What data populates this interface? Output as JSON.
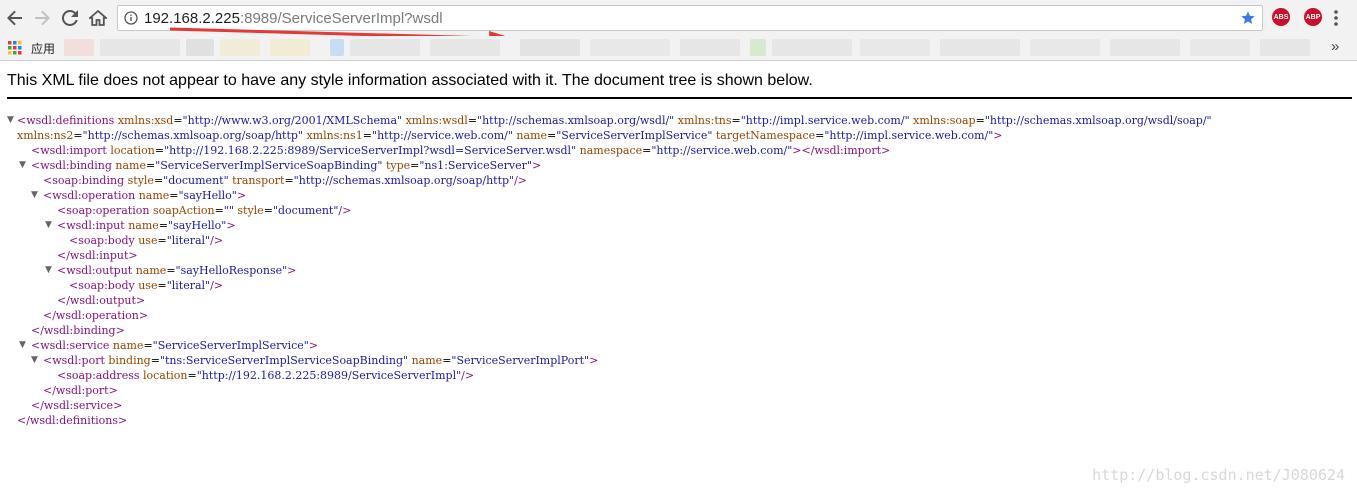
{
  "browser": {
    "url_host": "192.168.2.225",
    "url_rest": ":8989/ServiceServerImpl?wsdl",
    "apps_label": "应用",
    "ext_abs": "ABS",
    "ext_abp": "ABP",
    "more_glyph": "»"
  },
  "page": {
    "notice": "This XML file does not appear to have any style information associated with it. The document tree is shown below.",
    "watermark": "http://blog.csdn.net/J080624"
  },
  "colors": {
    "tag": "#881280",
    "attr": "#994500",
    "value": "#1a1aa6",
    "annotation_arrow": "#e53935"
  },
  "xml": {
    "l1": {
      "open": "<wsdl:definitions",
      "a1": "xmlns:xsd",
      "v1": "\"http://www.w3.org/2001/XMLSchema\"",
      "a2": "xmlns:wsdl",
      "v2": "\"http://schemas.xmlsoap.org/wsdl/\"",
      "a3": "xmlns:tns",
      "v3": "\"http://impl.service.web.com/\"",
      "a4": "xmlns:soap",
      "v4": "\"http://schemas.xmlsoap.org/wsdl/soap/\""
    },
    "l2": {
      "a1": "xmlns:ns2",
      "v1": "\"http://schemas.xmlsoap.org/soap/http\"",
      "a2": "xmlns:ns1",
      "v2": "\"http://service.web.com/\"",
      "a3": "name",
      "v3": "\"ServiceServerImplService\"",
      "a4": "targetNamespace",
      "v4": "\"http://impl.service.web.com/\"",
      "close": ">"
    },
    "l3": {
      "open": "<wsdl:import",
      "a1": "location",
      "v1": "\"http://192.168.2.225:8989/ServiceServerImpl?wsdl=ServiceServer.wsdl\"",
      "a2": "namespace",
      "v2": "\"http://service.web.com/\"",
      "close": "></wsdl:import>"
    },
    "l4": {
      "open": "<wsdl:binding",
      "a1": "name",
      "v1": "\"ServiceServerImplServiceSoapBinding\"",
      "a2": "type",
      "v2": "\"ns1:ServiceServer\"",
      "close": ">"
    },
    "l5": {
      "open": "<soap:binding",
      "a1": "style",
      "v1": "\"document\"",
      "a2": "transport",
      "v2": "\"http://schemas.xmlsoap.org/soap/http\"",
      "close": "/>"
    },
    "l6": {
      "open": "<wsdl:operation",
      "a1": "name",
      "v1": "\"sayHello\"",
      "close": ">"
    },
    "l7": {
      "open": "<soap:operation",
      "a1": "soapAction",
      "v1": "\"\"",
      "a2": "style",
      "v2": "\"document\"",
      "close": "/>"
    },
    "l8": {
      "open": "<wsdl:input",
      "a1": "name",
      "v1": "\"sayHello\"",
      "close": ">"
    },
    "l9": {
      "open": "<soap:body",
      "a1": "use",
      "v1": "\"literal\"",
      "close": "/>"
    },
    "l10": {
      "tag": "</wsdl:input>"
    },
    "l11": {
      "open": "<wsdl:output",
      "a1": "name",
      "v1": "\"sayHelloResponse\"",
      "close": ">"
    },
    "l12": {
      "open": "<soap:body",
      "a1": "use",
      "v1": "\"literal\"",
      "close": "/>"
    },
    "l13": {
      "tag": "</wsdl:output>"
    },
    "l14": {
      "tag": "</wsdl:operation>"
    },
    "l15": {
      "tag": "</wsdl:binding>"
    },
    "l16": {
      "open": "<wsdl:service",
      "a1": "name",
      "v1": "\"ServiceServerImplService\"",
      "close": ">"
    },
    "l17": {
      "open": "<wsdl:port",
      "a1": "binding",
      "v1": "\"tns:ServiceServerImplServiceSoapBinding\"",
      "a2": "name",
      "v2": "\"ServiceServerImplPort\"",
      "close": ">"
    },
    "l18": {
      "open": "<soap:address",
      "a1": "location",
      "v1": "\"http://192.168.2.225:8989/ServiceServerImpl\"",
      "close": "/>"
    },
    "l19": {
      "tag": "</wsdl:port>"
    },
    "l20": {
      "tag": "</wsdl:service>"
    },
    "l21": {
      "tag": "</wsdl:definitions>"
    }
  }
}
